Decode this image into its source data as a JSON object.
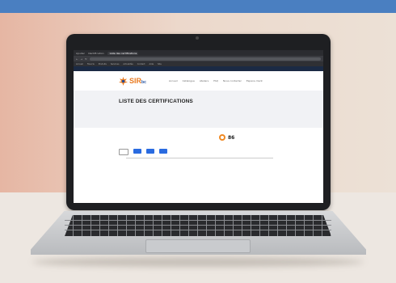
{
  "browser": {
    "tabs": [
      "Ajouter",
      "Identification",
      "Liste des certifications"
    ],
    "url": "",
    "bookmarks": [
      "Accueil",
      "Favoris",
      "Produits",
      "Services",
      "Actualités",
      "Contact",
      "Aide",
      "Site"
    ]
  },
  "site": {
    "topbar_left": "",
    "topbar_right": "",
    "logo_text": "SIR",
    "logo_suffix": "bc",
    "nav": [
      "Accueil",
      "Catalogue",
      "Ateliers",
      "FAQ",
      "Nous contacter",
      "Espace client"
    ]
  },
  "page": {
    "title": "LISTE DES CERTIFICATIONS",
    "breadcrumb": ""
  },
  "info": {
    "left_heading": "",
    "left_text": "",
    "mid_text": "",
    "score": "86",
    "score_sub": ""
  },
  "buttons": [
    "",
    "",
    "",
    ""
  ],
  "table": {
    "headers": [
      "",
      "",
      "",
      "",
      "",
      ""
    ],
    "rows": [
      [
        "",
        "",
        "",
        "",
        "",
        ""
      ]
    ]
  },
  "colors": {
    "accent_orange": "#e97a1f",
    "accent_blue": "#2a6be0",
    "site_dark": "#1b2a44",
    "banner_blue": "#4a7fc1"
  }
}
